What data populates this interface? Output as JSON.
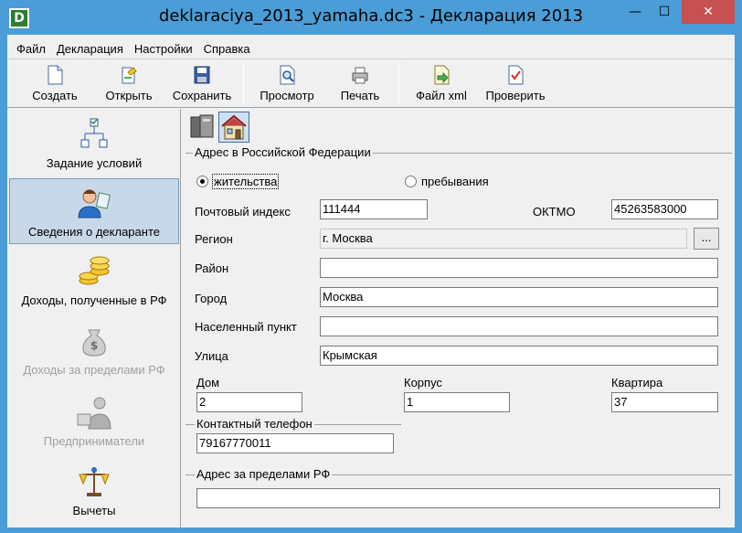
{
  "window": {
    "title": "deklaraciya_2013_yamaha.dc3 - Декларация 2013",
    "app_icon_letter": "D",
    "minimize": "—",
    "maximize": "☐",
    "close": "✕"
  },
  "menu": [
    "Файл",
    "Декларация",
    "Настройки",
    "Справка"
  ],
  "toolbar": {
    "create": "Создать",
    "open": "Открыть",
    "save": "Сохранить",
    "preview": "Просмотр",
    "print": "Печать",
    "xml": "Файл xml",
    "check": "Проверить"
  },
  "sidebar": {
    "items": [
      {
        "label": "Задание условий",
        "icon": "flowchart-icon",
        "state": "normal"
      },
      {
        "label": "Сведения о декларанте",
        "icon": "person-icon",
        "state": "active"
      },
      {
        "label": "Доходы, полученные в РФ",
        "icon": "coins-icon",
        "state": "normal"
      },
      {
        "label": "Доходы за пределами РФ",
        "icon": "money-bag-icon",
        "state": "disabled"
      },
      {
        "label": "Предприниматели",
        "icon": "entrepreneur-icon",
        "state": "disabled"
      },
      {
        "label": "Вычеты",
        "icon": "deductions-icon",
        "state": "normal"
      }
    ]
  },
  "tabs": {
    "icons": [
      "document-icon",
      "house-icon"
    ],
    "selected": "house-icon"
  },
  "address_rf": {
    "group_title": "Адрес в Российской Федерации",
    "radio_residence": "жительства",
    "radio_stay": "пребывания",
    "selected_radio": "жительства",
    "postcode_label": "Почтовый индекс",
    "postcode": "111444",
    "oktmo_label": "ОКТМО",
    "oktmo": "45263583000",
    "region_label": "Регион",
    "region": "г. Москва",
    "region_button": "...",
    "district_label": "Район",
    "district": "",
    "city_label": "Город",
    "city": "Москва",
    "locality_label": "Населенный пункт",
    "locality": "",
    "street_label": "Улица",
    "street": "Крымская",
    "house_label": "Дом",
    "house": "2",
    "building_label": "Корпус",
    "building": "1",
    "flat_label": "Квартира",
    "flat": "37"
  },
  "phone": {
    "group_title": "Контактный телефон",
    "value": "79167770011"
  },
  "address_abroad": {
    "group_title": "Адрес за пределами РФ",
    "value": ""
  }
}
